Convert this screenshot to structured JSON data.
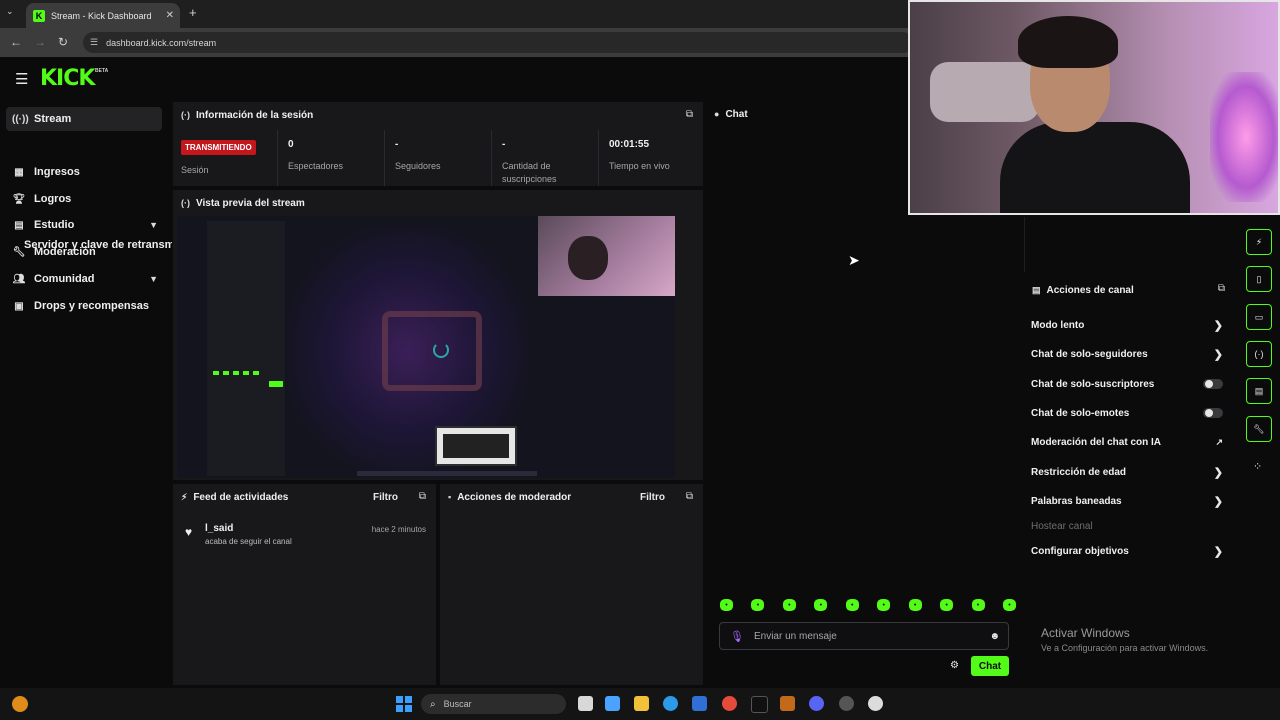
{
  "browser": {
    "tab_title": "Stream - Kick Dashboard",
    "url": "dashboard.kick.com/stream"
  },
  "app": {
    "logo": "KICK",
    "logo_badge": "BETA"
  },
  "sidebar": {
    "items": [
      {
        "label": "Stream",
        "icon": "broadcast-icon"
      },
      {
        "label": "Servidor y clave de retransmisión"
      },
      {
        "label": "Ingresos",
        "icon": "chart-icon"
      },
      {
        "label": "Logros",
        "icon": "trophy-icon"
      },
      {
        "label": "Estudio",
        "icon": "studio-icon"
      },
      {
        "label": "Moderación",
        "icon": "wrench-icon"
      },
      {
        "label": "Comunidad",
        "icon": "people-icon"
      },
      {
        "label": "Drops y recompensas",
        "icon": "gift-icon"
      }
    ]
  },
  "session": {
    "title": "Información de la sesión",
    "badge": "TRANSMITIENDO",
    "session_label": "Sesión",
    "stats": [
      {
        "value": "0",
        "label": "Espectadores"
      },
      {
        "value": "-",
        "label": "Seguidores"
      },
      {
        "value": "-",
        "label": "Cantidad de suscripciones"
      },
      {
        "value": "00:01:55",
        "label": "Tiempo en vivo"
      }
    ]
  },
  "preview": {
    "title": "Vista previa del stream"
  },
  "activity": {
    "title": "Feed de actividades",
    "filter": "Filtro",
    "items": [
      {
        "user": "l_said",
        "desc": "acaba de seguir el canal",
        "time": "hace 2 minutos"
      }
    ]
  },
  "mod_actions": {
    "title": "Acciones de moderador",
    "filter": "Filtro"
  },
  "chat": {
    "title": "Chat",
    "placeholder": "Enviar un mensaje",
    "send_label": "Chat",
    "emote_count": 10
  },
  "channel_actions": {
    "title": "Acciones de canal",
    "items": [
      {
        "label": "Modo lento",
        "control": "chevron"
      },
      {
        "label": "Chat de solo-seguidores",
        "control": "chevron"
      },
      {
        "label": "Chat de solo-suscriptores",
        "control": "toggle"
      },
      {
        "label": "Chat de solo-emotes",
        "control": "toggle"
      },
      {
        "label": "Moderación del chat con IA",
        "control": "external"
      },
      {
        "label": "Restricción de edad",
        "control": "chevron"
      },
      {
        "label": "Palabras baneadas",
        "control": "chevron"
      },
      {
        "label": "Hostear canal",
        "control": "none",
        "disabled": true
      },
      {
        "label": "Configurar objetivos",
        "control": "chevron"
      }
    ]
  },
  "windows_notice": {
    "title": "Activar Windows",
    "subtitle": "Ve a Configuración para activar Windows."
  },
  "taskbar": {
    "search_placeholder": "Buscar"
  },
  "colors": {
    "accent": "#53fc18",
    "live": "#c4171d",
    "panel": "#18181b",
    "background": "#0b0b0c"
  }
}
